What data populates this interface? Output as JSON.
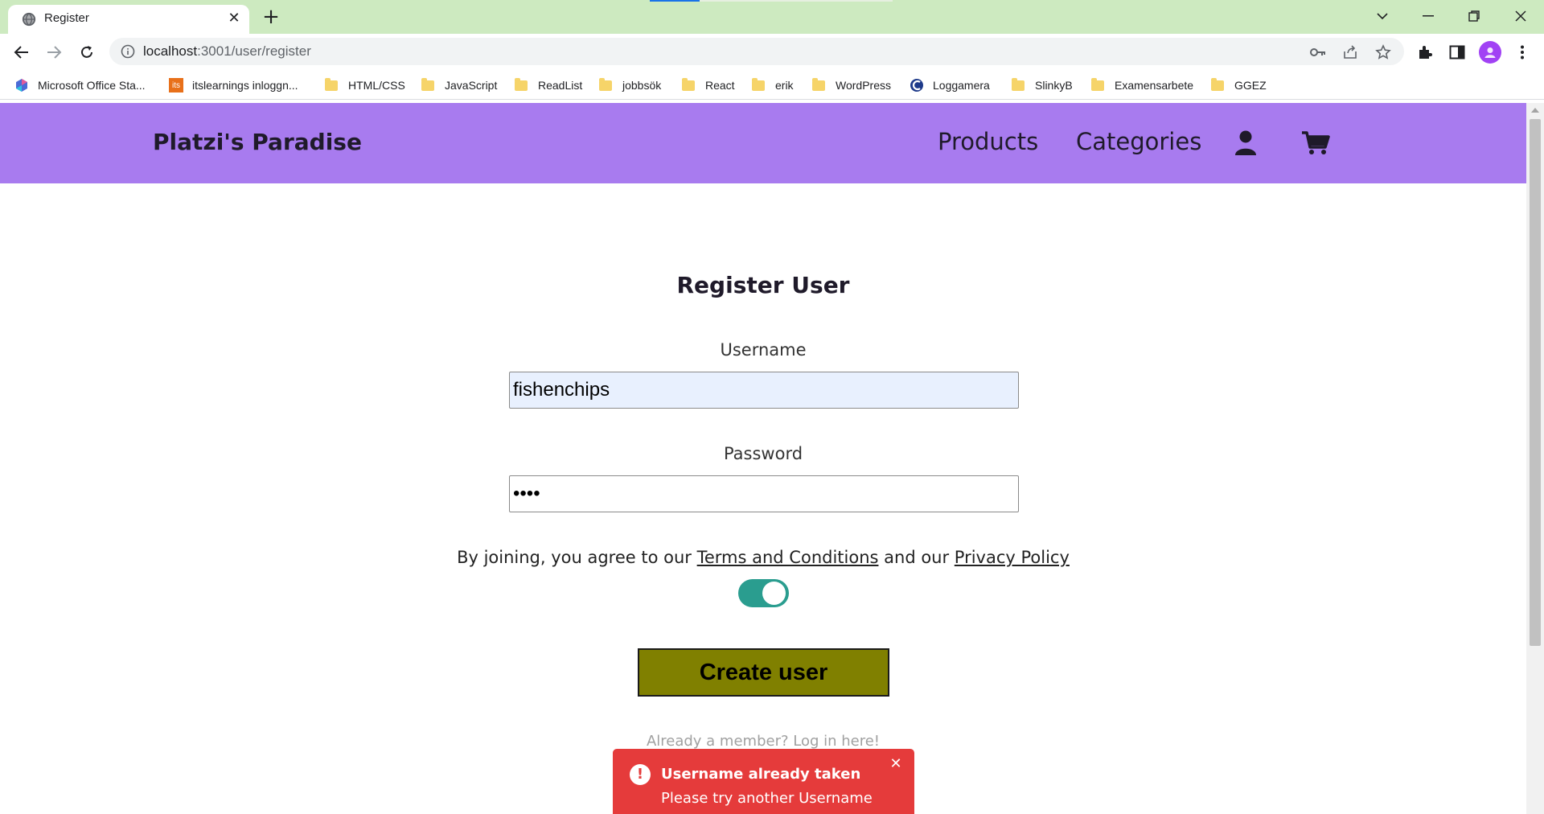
{
  "browser": {
    "tab": {
      "title": "Register",
      "icon": "globe-icon"
    },
    "address": {
      "host": "localhost",
      "rest": ":3001/user/register"
    },
    "bookmarks": [
      {
        "label": "Microsoft Office Sta...",
        "icon": "office-icon"
      },
      {
        "label": "itslearnings inloggn...",
        "icon": "its-icon"
      },
      {
        "label": "HTML/CSS",
        "icon": "folder-icon"
      },
      {
        "label": "JavaScript",
        "icon": "folder-icon"
      },
      {
        "label": "ReadList",
        "icon": "folder-icon"
      },
      {
        "label": "jobbsök",
        "icon": "folder-icon"
      },
      {
        "label": "React",
        "icon": "folder-icon"
      },
      {
        "label": "erik",
        "icon": "folder-icon"
      },
      {
        "label": "WordPress",
        "icon": "folder-icon"
      },
      {
        "label": "Loggamera",
        "icon": "loggamera-icon"
      },
      {
        "label": "SlinkyB",
        "icon": "folder-icon"
      },
      {
        "label": "Examensarbete",
        "icon": "folder-icon"
      },
      {
        "label": "GGEZ",
        "icon": "folder-icon"
      }
    ],
    "its_favicon_text": "its"
  },
  "site": {
    "brand": "Platzi's Paradise",
    "nav": {
      "products": "Products",
      "categories": "Categories"
    },
    "colors": {
      "header": "#a87bef",
      "button": "#808000",
      "toggle": "#2a9d8f",
      "toast": "#e53b3b"
    }
  },
  "form": {
    "title": "Register User",
    "username_label": "Username",
    "username_value": "fishenchips",
    "password_label": "Password",
    "password_value": "abcd",
    "agree_prefix": "By joining, you agree to our ",
    "terms_link": "Terms and Conditions",
    "agree_mid": " and our ",
    "privacy_link": "Privacy Policy",
    "toggle_on": true,
    "submit_label": "Create user",
    "login_link": "Already a member? Log in here!"
  },
  "toast": {
    "title": "Username already taken",
    "message": "Please try another Username",
    "icon": "exclamation-icon"
  }
}
